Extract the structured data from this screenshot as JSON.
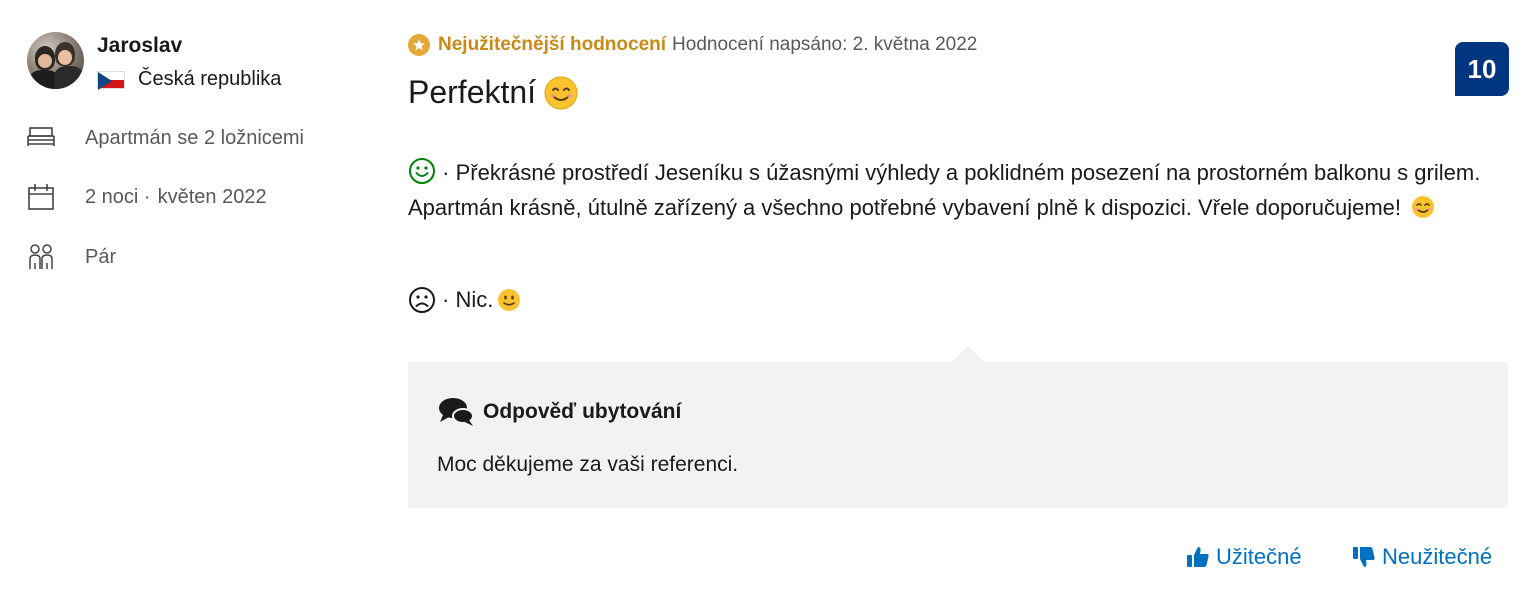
{
  "reviewer": {
    "name": "Jaroslav",
    "country": "Česká republika"
  },
  "stay": {
    "room": "Apartmán se 2 ložnicemi",
    "nights": "2 noci ·",
    "month": "květen 2022",
    "traveler_type": "Pár"
  },
  "review": {
    "badge": "Nejužitečnější hodnocení",
    "date": "Hodnocení napsáno: 2. května 2022",
    "title": "Perfektní",
    "score": "10",
    "positive_prefix": "·",
    "positive_text": "Překrásné prostředí Jeseníku s úžasnými výhledy a poklidném posezení na prostorném balkonu s grilem. Apartmán krásně, útulně zařízený a všechno potřebné vybavení plně k dispozici. Vřele doporučujeme!",
    "negative_text": "· Nic."
  },
  "reply": {
    "title": "Odpověď ubytování",
    "text": "Moc děkujeme za vaši referenci."
  },
  "actions": {
    "helpful": "Užitečné",
    "not_helpful": "Neužitečné"
  },
  "colors": {
    "accent": "#0071c2",
    "score_bg": "#003580",
    "badge": "#c98a18",
    "reply_bg": "#f2f2f2"
  },
  "icons": [
    "avatar",
    "cz-flag-icon",
    "bed-icon",
    "calendar-icon",
    "people-icon",
    "star-badge-icon",
    "smile-emoji-icon",
    "happy-face-icon",
    "sad-face-icon",
    "slight-smile-emoji-icon",
    "chat-bubbles-icon",
    "thumbs-up-icon",
    "thumbs-down-icon"
  ]
}
